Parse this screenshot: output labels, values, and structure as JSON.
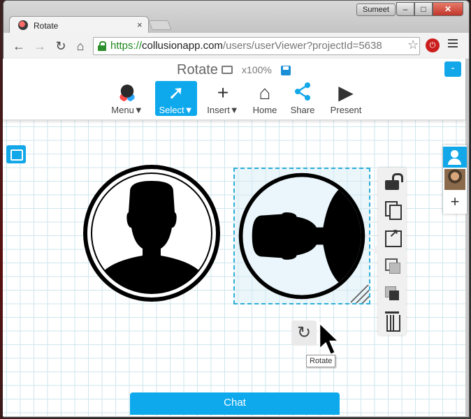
{
  "browser": {
    "user_badge": "Sumeet",
    "min_label": "–",
    "max_label": "□",
    "close_label": "✕",
    "tab": {
      "title": "Rotate",
      "close": "×"
    },
    "nav": {
      "back": "←",
      "forward": "→",
      "reload": "↻",
      "home": "⌂"
    },
    "address": {
      "scheme": "https://",
      "host": "collusionapp.com",
      "path": "/users/userViewer?projectId=5638"
    },
    "star": "☆",
    "ext_label": "⏻"
  },
  "app": {
    "title": "Rotate",
    "zoom": "x100%",
    "collapse_label": "-",
    "tools": [
      {
        "label": "Menu▼"
      },
      {
        "label": "Select▼",
        "glyph": "➚"
      },
      {
        "label": "Insert▼",
        "glyph": "+"
      },
      {
        "label": "Home",
        "glyph": "⌂"
      },
      {
        "label": "Share",
        "glyph": "⋖"
      },
      {
        "label": "Present",
        "glyph": "▶"
      }
    ],
    "add_user": "+",
    "rotate_glyph": "↻",
    "tooltip": "Rotate",
    "chat": "Chat",
    "accent_color": "#0ea9ec"
  }
}
